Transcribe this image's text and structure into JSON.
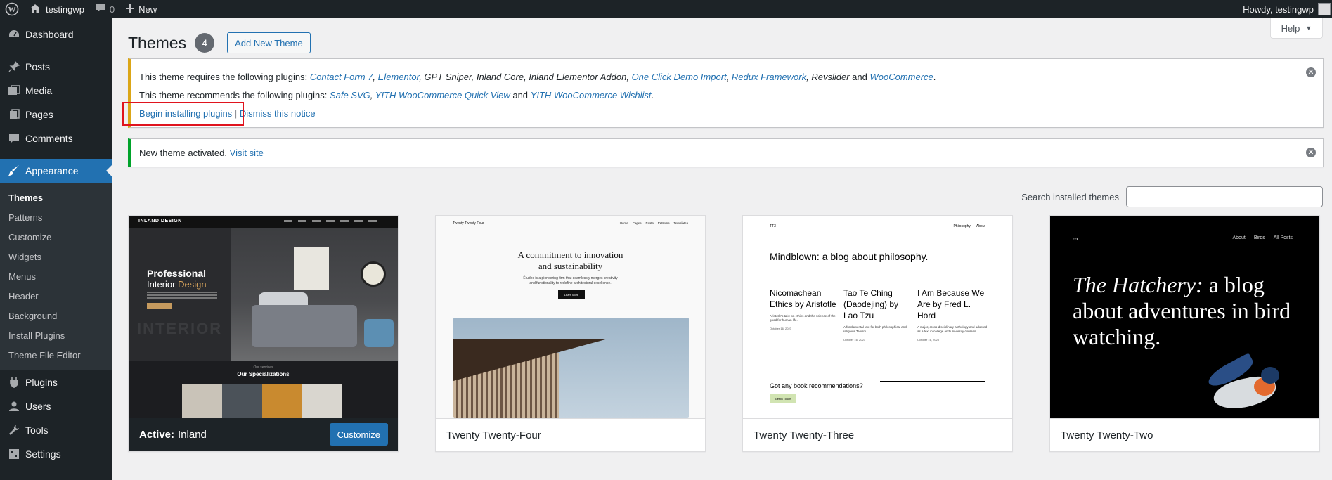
{
  "adminbar": {
    "site_name": "testingwp",
    "comments_count": "0",
    "new_label": "New",
    "howdy": "Howdy, testingwp"
  },
  "sidebar": {
    "items": [
      {
        "label": "Dashboard",
        "icon": "dashboard-icon"
      },
      {
        "label": "Posts",
        "icon": "pin-icon"
      },
      {
        "label": "Media",
        "icon": "media-icon"
      },
      {
        "label": "Pages",
        "icon": "pages-icon"
      },
      {
        "label": "Comments",
        "icon": "comment-icon"
      },
      {
        "label": "Appearance",
        "icon": "brush-icon"
      },
      {
        "label": "Plugins",
        "icon": "plugin-icon"
      },
      {
        "label": "Users",
        "icon": "users-icon"
      },
      {
        "label": "Tools",
        "icon": "wrench-icon"
      },
      {
        "label": "Settings",
        "icon": "settings-icon"
      }
    ],
    "appearance_sub": [
      "Themes",
      "Patterns",
      "Customize",
      "Widgets",
      "Menus",
      "Header",
      "Background",
      "Install Plugins",
      "Theme File Editor"
    ]
  },
  "header": {
    "title": "Themes",
    "count": "4",
    "add_new": "Add New Theme",
    "help": "Help"
  },
  "notice_plugins": {
    "requires_prefix": "This theme requires the following plugins:",
    "required": [
      "Contact Form 7",
      "Elementor",
      "GPT Sniper",
      "Inland Core",
      "Inland Elementor Addon",
      "One Click Demo Import",
      "Redux Framework",
      "Revslider",
      "WooCommerce"
    ],
    "recommends_prefix": "This theme recommends the following plugins:",
    "recommended": [
      "Safe SVG",
      "YITH WooCommerce Quick View",
      "YITH WooCommerce Wishlist"
    ],
    "and_word": "and",
    "begin_installing": "Begin installing plugins",
    "separator": "|",
    "dismiss": "Dismiss this notice"
  },
  "notice_activated": {
    "text": "New theme activated.",
    "link": "Visit site"
  },
  "search": {
    "label": "Search installed themes",
    "placeholder": ""
  },
  "themes": [
    {
      "name": "Inland",
      "active_prefix": "Active:",
      "customize": "Customize"
    },
    {
      "name": "Twenty Twenty-Four"
    },
    {
      "name": "Twenty Twenty-Three"
    },
    {
      "name": "Twenty Twenty-Two"
    }
  ],
  "previews": {
    "inland": {
      "logo": "INLAND DESIGN",
      "headline1": "Professional",
      "headline2a": "Interior ",
      "headline2b": "Design",
      "watermark": "INTERIOR",
      "kicker": "Our services",
      "section": "Our Specializations"
    },
    "tt4": {
      "site": "Twenty Twenty Four",
      "nav": [
        "Home",
        "Pages",
        "Posts",
        "Patterns",
        "Templates"
      ],
      "headline": "A commitment to innovation and sustainability",
      "desc": "Études is a pioneering firm that seamlessly merges creativity and functionality to redefine architectural excellence.",
      "button": "Learn More"
    },
    "tt3": {
      "site": "TT3",
      "nav": [
        "Philosophy",
        "About"
      ],
      "headline": "Mindblown: a blog about philosophy.",
      "posts": [
        {
          "title": "Nicomachean Ethics by Aristotle",
          "desc": "Aristotle's take on ethics and the science of the good for human life.",
          "date": "October 16, 2023"
        },
        {
          "title": "Tao Te Ching (Daodejing) by Lao Tzu",
          "desc": "A fundamental text for both philosophical and religious Taoism.",
          "date": "October 16, 2023"
        },
        {
          "title": "I Am Because We Are by Fred L. Hord",
          "desc": "A major, cross-disciplinary anthology and adopted as a text in college and university courses.",
          "date": "October 16, 2023"
        }
      ],
      "ask": "Got any book recommendations?",
      "button": "Get In Touch"
    },
    "tt2": {
      "logo": "∞",
      "nav": [
        "About",
        "Birds",
        "All Posts"
      ],
      "headline_italic": "The Hatchery:",
      "headline_rest": " a blog about adventures in bird watching."
    }
  },
  "colors": {
    "admin_dark": "#1d2327",
    "accent": "#2271b1",
    "warning": "#dba617",
    "success": "#00a32a",
    "highlight": "#e0141e"
  }
}
